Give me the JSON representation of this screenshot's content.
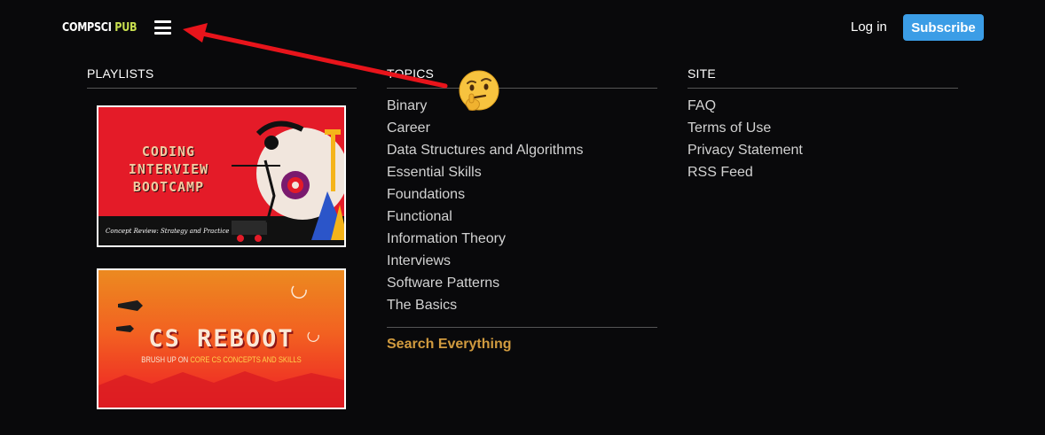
{
  "header": {
    "logo_part1": "COMPSCI",
    "logo_part2": "PUB",
    "login_label": "Log in",
    "subscribe_label": "Subscribe"
  },
  "playlists": {
    "heading": "PLAYLISTS",
    "items": [
      {
        "title": "CODING INTERVIEW BOOTCAMP",
        "subtitle": "Concept Review: Strategy and Practice"
      },
      {
        "title": "CS REBOOT",
        "subtitle_before": "BRUSH UP ON ",
        "subtitle_highlight1": "CORE CS CONCEPTS",
        "subtitle_middle": " ",
        "subtitle_highlight2": "AND SKILLS"
      }
    ]
  },
  "topics": {
    "heading": "TOPICS",
    "items": [
      "Binary",
      "Career",
      "Data Structures and Algorithms",
      "Essential Skills",
      "Foundations",
      "Functional",
      "Information Theory",
      "Interviews",
      "Software Patterns",
      "The Basics"
    ],
    "search_label": "Search Everything"
  },
  "site": {
    "heading": "SITE",
    "items": [
      "FAQ",
      "Terms of Use",
      "Privacy Statement",
      "RSS Feed"
    ]
  },
  "annotations": {
    "arrow_color": "#e8141b",
    "emoji": "thinking-face"
  },
  "colors": {
    "accent": "#3b9de6",
    "search": "#d19b3f",
    "logo_highlight": "#c8df4f"
  }
}
